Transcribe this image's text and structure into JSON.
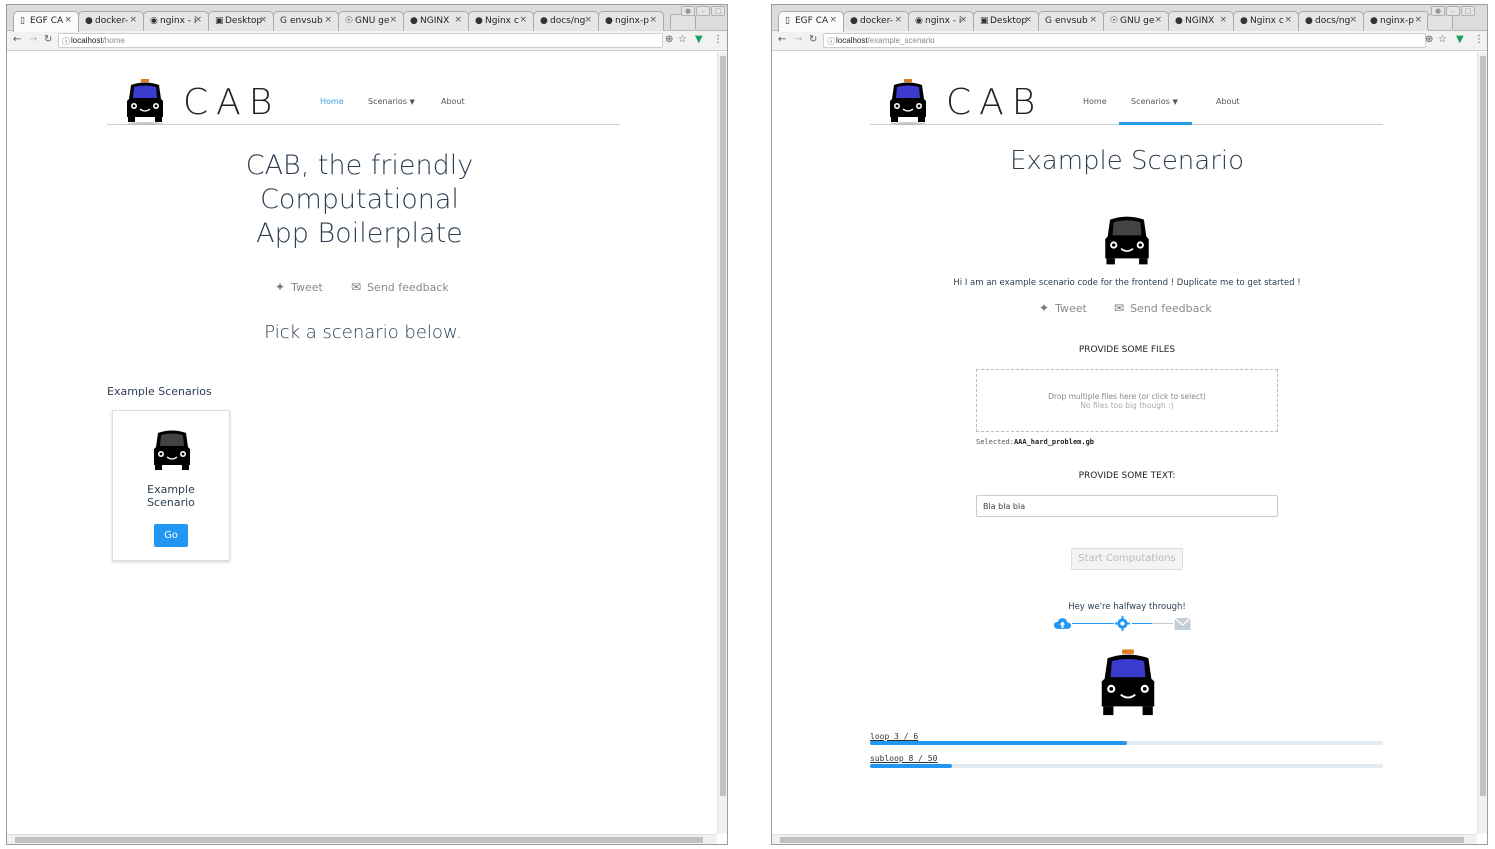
{
  "browser_left": {
    "tabs": [
      {
        "icon": "page-icon",
        "title": "EGF CA",
        "active": true
      },
      {
        "icon": "github-icon",
        "title": "docker-",
        "active": false
      },
      {
        "icon": "nginx-icon",
        "title": "nginx - i",
        "active": false
      },
      {
        "icon": "desktop-icon",
        "title": "Desktop",
        "active": false
      },
      {
        "icon": "google-icon",
        "title": "envsub",
        "active": false
      },
      {
        "icon": "gnu-icon",
        "title": "GNU ge",
        "active": false
      },
      {
        "icon": "github-icon",
        "title": "NGINX",
        "active": false
      },
      {
        "icon": "github-icon",
        "title": "Nginx c",
        "active": false
      },
      {
        "icon": "github-icon",
        "title": "docs/ng",
        "active": false
      },
      {
        "icon": "github-icon",
        "title": "nginx-p",
        "active": false
      }
    ],
    "url_host": "localhost",
    "url_path": "/home"
  },
  "browser_right": {
    "tabs": [
      {
        "icon": "page-icon",
        "title": "EGF CA",
        "active": true
      },
      {
        "icon": "github-icon",
        "title": "docker-",
        "active": false
      },
      {
        "icon": "nginx-icon",
        "title": "nginx - i",
        "active": false
      },
      {
        "icon": "desktop-icon",
        "title": "Desktop",
        "active": false
      },
      {
        "icon": "google-icon",
        "title": "envsub",
        "active": false
      },
      {
        "icon": "gnu-icon",
        "title": "GNU ge",
        "active": false
      },
      {
        "icon": "github-icon",
        "title": "NGINX",
        "active": false
      },
      {
        "icon": "github-icon",
        "title": "Nginx c",
        "active": false
      },
      {
        "icon": "github-icon",
        "title": "docs/ng",
        "active": false
      },
      {
        "icon": "github-icon",
        "title": "nginx-p",
        "active": false
      }
    ],
    "url_host": "localhost",
    "url_path": "/example_scenario"
  },
  "site": {
    "brand": "CAB",
    "nav": {
      "home": "Home",
      "scenarios": "Scenarios",
      "about": "About"
    },
    "social": {
      "tweet": "Tweet",
      "feedback": "Send feedback"
    }
  },
  "home": {
    "title_line1": "CAB, the friendly",
    "title_line2": "Computational",
    "title_line3": "App Boilerplate",
    "pick": "Pick a scenario below.",
    "section": "Example Scenarios",
    "card_title_line1": "Example",
    "card_title_line2": "Scenario",
    "go": "Go"
  },
  "scenario": {
    "title": "Example Scenario",
    "intro": "Hi I am an example scenario code for the frontend ! Duplicate me to get started !",
    "files_label": "PROVIDE SOME FILES",
    "drop_line1": "Drop multiple files here (or click to select)",
    "drop_line2": "No files too big though :)",
    "selected_prefix": "Selected:",
    "selected_file": "AAA_hard_problem.gb",
    "text_label": "PROVIDE SOME TEXT:",
    "text_value": "Bla bla bla",
    "start": "Start Computations",
    "status": "Hey we're halfway through!",
    "loop_label": "loop 3 / 6",
    "loop_fraction": 0.5,
    "subloop_label": "subloop 8 / 50",
    "subloop_fraction": 0.16
  },
  "colors": {
    "accent": "#2196f3",
    "heading": "#2d3e50"
  }
}
